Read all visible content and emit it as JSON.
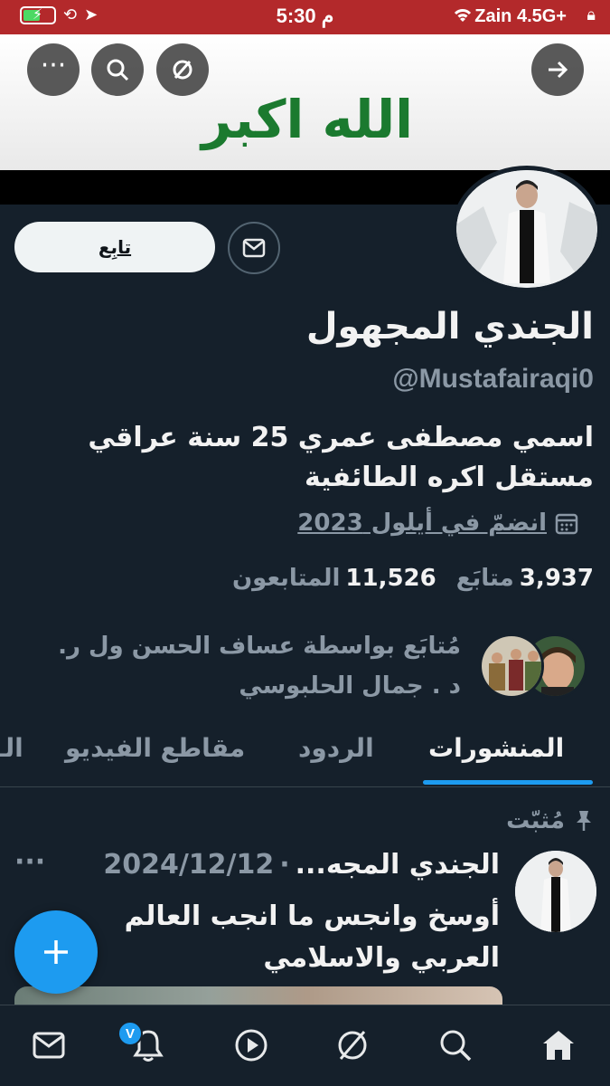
{
  "status_bar": {
    "time": "5:30 م",
    "carrier": "Zain 4.5G+"
  },
  "banner": {
    "text": "الله اكبر"
  },
  "profile": {
    "follow_label": "تابِع",
    "name": "الجندي المجهول",
    "handle": "@Mustafairaqi0",
    "bio_line1": "اسمي مصطفى عمري 25 سنة عراقي",
    "bio_line2": "مستقل اكره الطائفية",
    "joined": "انضمّ في أيلول 2023",
    "following_count": "3,937",
    "following_label": "متابَع",
    "followers_count": "11,526",
    "followers_label": "المتابعون",
    "followed_by_line1": "مُتابَع بواسطة عساف الحسن ول ر.",
    "followed_by_line2": "د . جمال الحلبوسي"
  },
  "tabs": [
    {
      "label": "المنشورات",
      "active": true
    },
    {
      "label": "الردود",
      "active": false
    },
    {
      "label": "مقاطع الفيديو",
      "active": false
    },
    {
      "label": "الـ",
      "active": false
    }
  ],
  "pinned_post": {
    "pinned_label": "مُثبّت",
    "author": "الجندي المجه...",
    "date": "2024/12/12",
    "text": "أوسخ وانجس ما انجب العالم العربي والاسلامي"
  },
  "nav": {
    "notification_badge": "V"
  },
  "colors": {
    "background": "#15202b",
    "accent": "#1d9bf0",
    "banner_text": "#1b7a2f",
    "status_bar": "#b3292b"
  }
}
